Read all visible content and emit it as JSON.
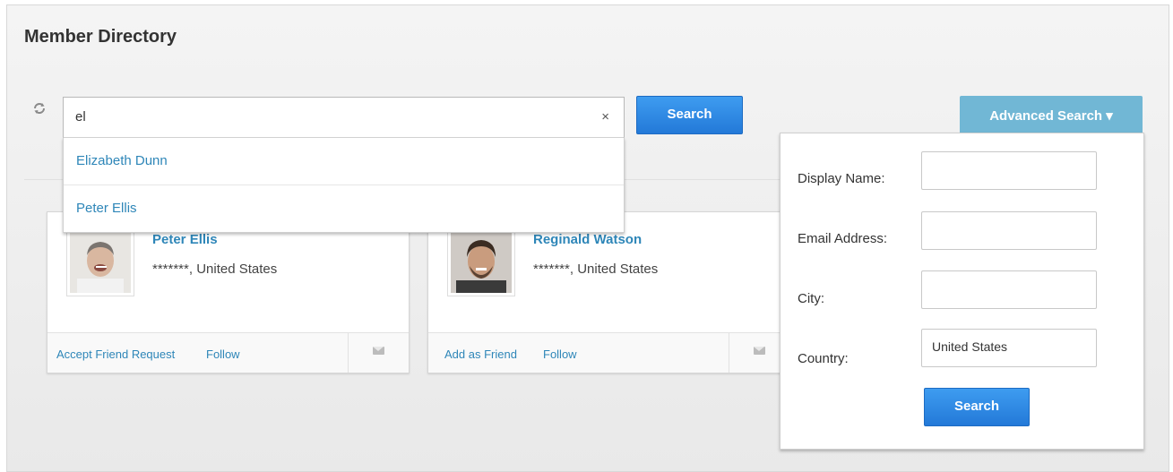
{
  "page": {
    "title": "Member Directory"
  },
  "search": {
    "value": "el",
    "clear_label": "×",
    "button_label": "Search"
  },
  "suggestions": [
    {
      "label": "Elizabeth Dunn"
    },
    {
      "label": "Peter Ellis"
    }
  ],
  "members": [
    {
      "name": "Peter Ellis",
      "location": "*******, United States",
      "actions": [
        "Accept Friend Request",
        "Follow"
      ]
    },
    {
      "name": "Reginald Watson",
      "location": "*******, United States",
      "actions": [
        "Add as Friend",
        "Follow"
      ]
    }
  ],
  "advanced": {
    "toggle_label": "Advanced Search ▾",
    "fields": {
      "display_name": {
        "label": "Display Name:",
        "value": ""
      },
      "email": {
        "label": "Email Address:",
        "value": ""
      },
      "city": {
        "label": "City:",
        "value": ""
      },
      "country": {
        "label": "Country:",
        "value": "United States"
      }
    },
    "button_label": "Search"
  },
  "colors": {
    "link": "#2e86b8",
    "primary_button": "#2a86e0",
    "advanced_toggle": "#71b7d5"
  }
}
